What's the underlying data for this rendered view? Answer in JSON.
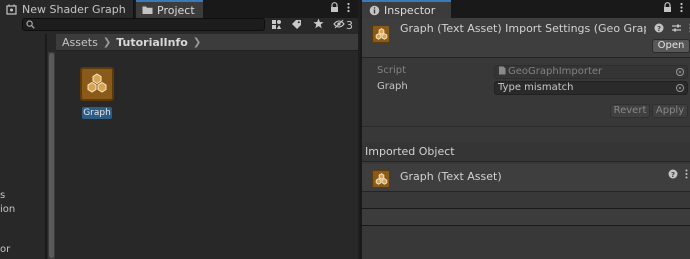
{
  "left_panel": {
    "tabs": [
      {
        "label": "New Shader Graph",
        "icon": "shader-graph-icon",
        "active": false
      },
      {
        "label": "Project",
        "icon": "folder-icon",
        "active": true
      }
    ],
    "window_controls": {
      "lock_icon": "lock-icon",
      "menu_icon": "kebab-menu-icon"
    },
    "toolbar": {
      "add_icon": "plus-icon",
      "search": {
        "value": "",
        "placeholder": ""
      },
      "filter_icons": [
        "filter-by-type-icon",
        "filter-by-label-icon",
        "favorites-star-icon"
      ],
      "hidden_packages_count": "3"
    },
    "tree_fragments": [
      "s",
      "ion",
      "or"
    ],
    "breadcrumb": {
      "root": "Assets",
      "current": "TutorialInfo"
    },
    "assets": [
      {
        "label": "Graph",
        "icon": "graph-asset-icon",
        "selected": true
      }
    ]
  },
  "inspector": {
    "tab": {
      "label": "Inspector",
      "icon": "info-icon"
    },
    "window_controls": {
      "lock_icon": "lock-icon",
      "menu_icon": "kebab-menu-icon"
    },
    "title": "Graph (Text Asset) Import Settings (Geo Graph",
    "header_icons": [
      "help-icon",
      "preset-icon",
      "kebab-menu-icon"
    ],
    "open_button": "Open",
    "properties": [
      {
        "label": "Script",
        "value": "GeoGraphImporter",
        "icon": "script-icon",
        "disabled": true
      },
      {
        "label": "Graph",
        "value": "Type mismatch",
        "disabled": false
      }
    ],
    "revert_button": "Revert",
    "apply_button": "Apply",
    "imported_object_header": "Imported Object",
    "imported_object": {
      "title": "Graph (Text Asset)",
      "icons": [
        "help-icon",
        "kebab-menu-icon"
      ]
    }
  },
  "colors": {
    "panel_dark": "#282828",
    "inspector_bg": "#383838",
    "tab_active_accent": "#3a79bb",
    "asset_icon_brown": "#8a5a18",
    "selection_blue": "#2c5d87"
  }
}
